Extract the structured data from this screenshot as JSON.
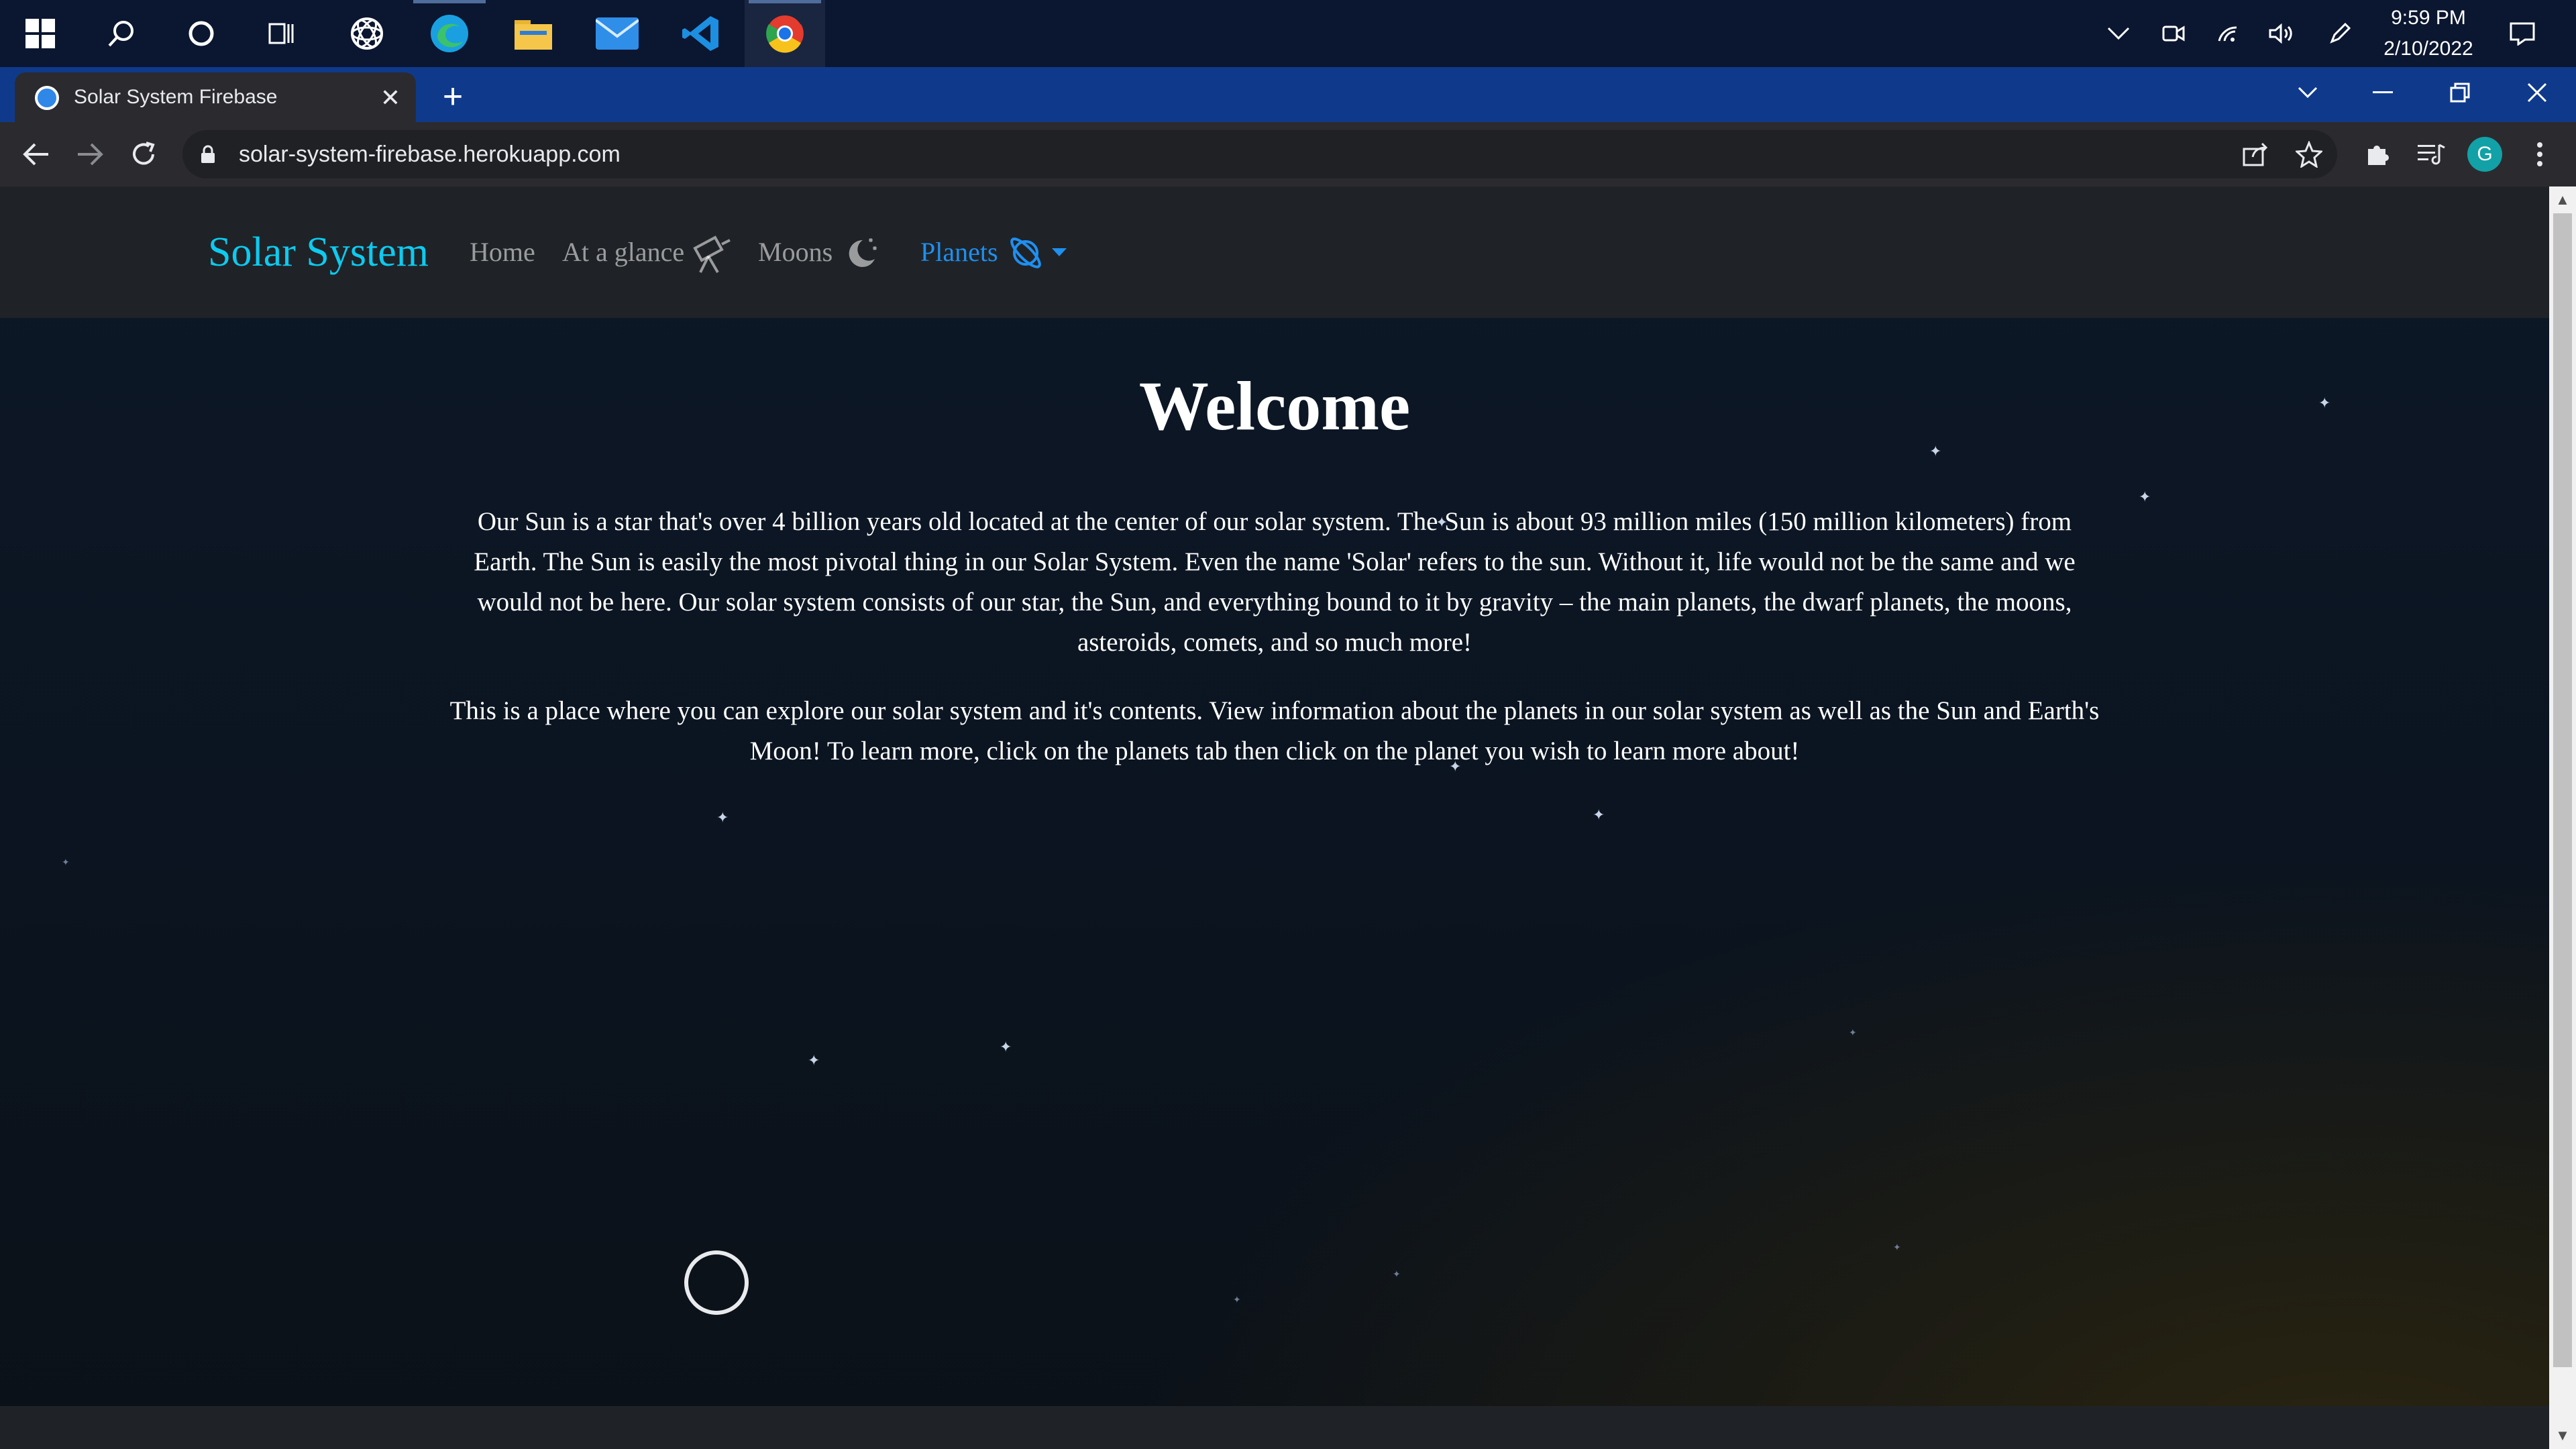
{
  "taskbar": {
    "icons": [
      "windows-start-icon",
      "search-icon",
      "cortana-icon",
      "task-view-icon",
      "openai-app-icon",
      "edge-icon",
      "file-explorer-icon",
      "mail-icon",
      "vscode-icon",
      "chrome-icon"
    ],
    "clock": {
      "time": "9:59 PM",
      "date": "2/10/2022"
    },
    "tray": [
      "show-hidden-icons-chevron-icon",
      "meet-now-icon",
      "wifi-icon",
      "volume-icon",
      "pen-icon",
      "notifications-icon"
    ]
  },
  "browser": {
    "tab": {
      "title": "Solar System Firebase",
      "close": "✕"
    },
    "new_tab": "+",
    "url": "solar-system-firebase.herokuapp.com",
    "profile_initial": "G",
    "accent": "#0f3a8c"
  },
  "page": {
    "navbar": {
      "brand": "Solar System",
      "links": [
        {
          "label": "Home"
        },
        {
          "label": "At a glance"
        },
        {
          "label": "Moons"
        },
        {
          "label": "Planets"
        }
      ],
      "brand_color": "#0dcaf0",
      "active_color": "#1f8ff0"
    },
    "title": "Welcome",
    "paragraphs": [
      "Our Sun is a star that's over 4 billion years old located at the center of our solar system. The Sun is about 93 million miles (150 million kilometers) from Earth. The Sun is easily the most pivotal thing in our Solar System. Even the name 'Solar' refers to the sun. Without it, life would not be the same and we would not be here. Our solar system consists of our star, the Sun, and everything bound to it by gravity – the main planets, the dwarf planets, the moons, asteroids, comets, and so much more!",
      "This is a place where you can explore our solar system and it's contents. View information about the planets in our solar system as well as the Sun and Earth's Moon! To learn more, click on the planets tab then click on the planet you wish to learn more about!"
    ]
  }
}
